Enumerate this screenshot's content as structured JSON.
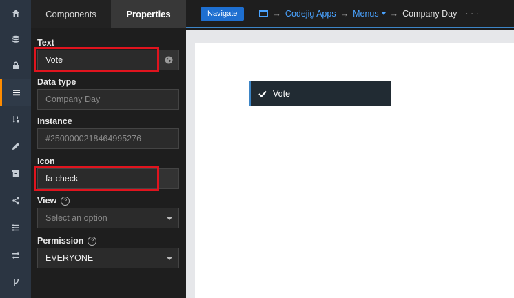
{
  "rail": {
    "items": [
      {
        "icon": "home-icon"
      },
      {
        "icon": "database-icon"
      },
      {
        "icon": "lock-icon"
      },
      {
        "icon": "menu-icon",
        "active": true
      },
      {
        "icon": "sort-icon"
      },
      {
        "icon": "pencil-icon"
      },
      {
        "icon": "archive-icon"
      },
      {
        "icon": "share-icon"
      },
      {
        "icon": "list-icon"
      },
      {
        "icon": "exchange-icon"
      },
      {
        "icon": "branch-icon"
      }
    ]
  },
  "panel": {
    "tabs": {
      "components": "Components",
      "properties": "Properties"
    },
    "fields": {
      "text": {
        "label": "Text",
        "value": "Vote"
      },
      "data_type": {
        "label": "Data type",
        "value": "Company Day"
      },
      "instance": {
        "label": "Instance",
        "value": "#2500000218464995276"
      },
      "icon": {
        "label": "Icon",
        "value": "fa-check"
      },
      "view": {
        "label": "View",
        "help": "?",
        "value": "Select an option"
      },
      "permission": {
        "label": "Permission",
        "help": "?",
        "value": "EVERYONE"
      }
    }
  },
  "topbar": {
    "navigate": "Navigate",
    "breadcrumb": {
      "sep": "→",
      "app": "Codejig Apps",
      "menus": "Menus",
      "current": "Company Day",
      "more": "· · ·"
    }
  },
  "preview": {
    "menu_item": {
      "label": "Vote",
      "icon": "check-icon"
    }
  },
  "colors": {
    "accent": "#ff8c00",
    "link": "#4aa3ff",
    "button": "#1e6fd0",
    "highlight": "#e0141e"
  }
}
